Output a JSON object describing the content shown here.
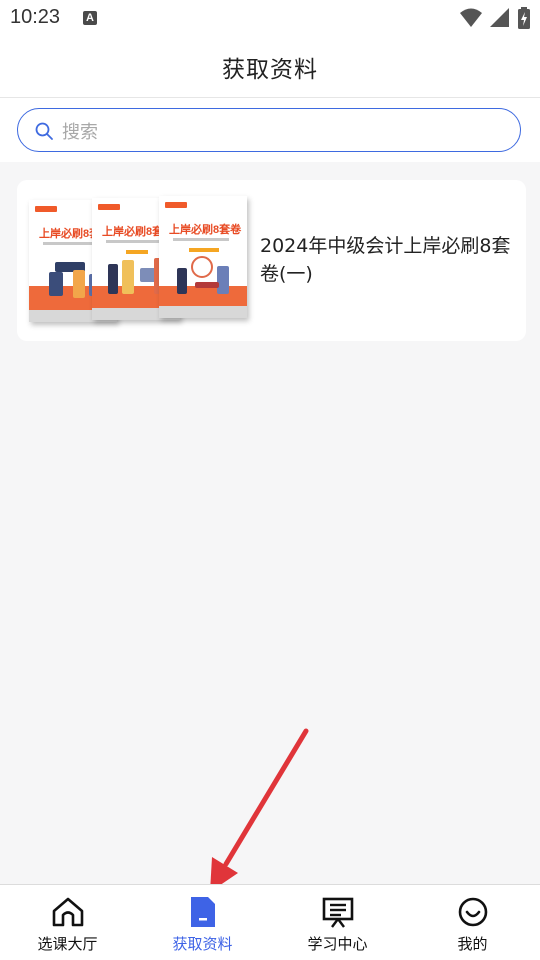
{
  "status_bar": {
    "time": "10:23",
    "notification_letter": "A",
    "icons": [
      "wifi-icon",
      "signal-icon",
      "battery-charging-icon"
    ]
  },
  "header": {
    "title": "获取资料"
  },
  "search": {
    "placeholder": "搜索",
    "border_color": "#3e6ae0"
  },
  "materials": [
    {
      "title": "2024年中级会计上岸必刷8套卷(一)",
      "cover_text": "上岸必刷8套卷"
    }
  ],
  "tab_bar": {
    "active_color": "#3e63e6",
    "tabs": [
      {
        "label": "选课大厅",
        "icon": "home-icon",
        "active": false
      },
      {
        "label": "获取资料",
        "icon": "document-icon",
        "active": true
      },
      {
        "label": "学习中心",
        "icon": "presentation-board-icon",
        "active": false
      },
      {
        "label": "我的",
        "icon": "smiley-face-icon",
        "active": false
      }
    ]
  },
  "annotation": {
    "arrow_color": "#e0353a",
    "arrow_target": "获取资料"
  }
}
